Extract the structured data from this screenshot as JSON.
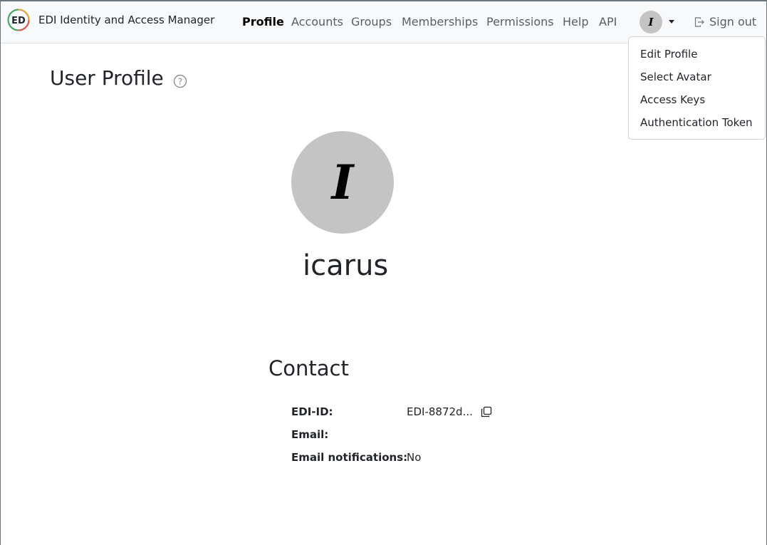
{
  "app": {
    "title": "EDI Identity and Access Manager"
  },
  "nav": {
    "items": [
      {
        "label": "Profile",
        "active": true
      },
      {
        "label": "Accounts",
        "active": false
      },
      {
        "label": "Groups",
        "active": false
      },
      {
        "label": "Memberships",
        "active": false
      },
      {
        "label": "Permissions",
        "active": false
      },
      {
        "label": "Help",
        "active": false
      },
      {
        "label": "API",
        "active": false
      }
    ],
    "avatar_initial": "I",
    "signout_label": "Sign out"
  },
  "dropdown": {
    "items": [
      "Edit Profile",
      "Select Avatar",
      "Access Keys",
      "Authentication Token"
    ]
  },
  "page": {
    "title": "User Profile",
    "avatar_initial": "I",
    "username": "icarus"
  },
  "contact": {
    "title": "Contact",
    "edi_id_label": "EDI-ID:",
    "edi_id_value": "EDI-8872d...",
    "email_label": "Email:",
    "email_value": "",
    "notifications_label": "Email notifications:",
    "notifications_value": "No"
  },
  "icons": {
    "logo": "edi-logo-icon",
    "help": "question-circle-icon",
    "signout": "box-arrow-right-icon",
    "copy": "copy-icon"
  },
  "colors": {
    "navbar_bg": "#f8f9fa",
    "avatar_bg": "#c4c4c4",
    "nav_text": "#595f64"
  }
}
